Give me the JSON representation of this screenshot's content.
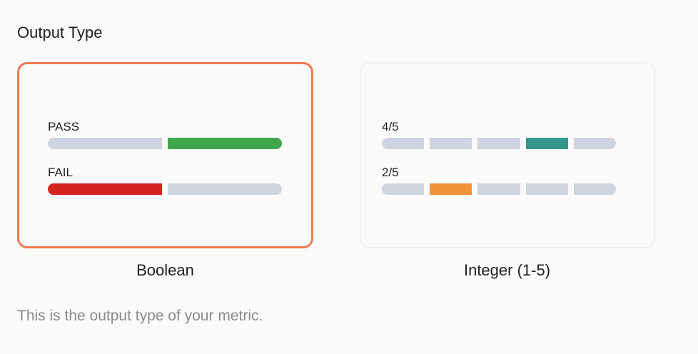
{
  "title": "Output Type",
  "options": [
    {
      "label": "Boolean",
      "selected": true,
      "rows": [
        {
          "label": "PASS",
          "segments": 2,
          "active_index": 1,
          "color": "#40a64d"
        },
        {
          "label": "FAIL",
          "segments": 2,
          "active_index": 0,
          "color": "#d42321"
        }
      ]
    },
    {
      "label": "Integer (1-5)",
      "selected": false,
      "rows": [
        {
          "label": "4/5",
          "segments": 5,
          "active_index": 3,
          "color": "#34968a"
        },
        {
          "label": "2/5",
          "segments": 5,
          "active_index": 1,
          "color": "#f29237"
        }
      ]
    }
  ],
  "help_text": "This is the output type of your metric.",
  "colors": {
    "selected_border": "#ef7b4f",
    "inactive_segment": "#ced5e1"
  }
}
